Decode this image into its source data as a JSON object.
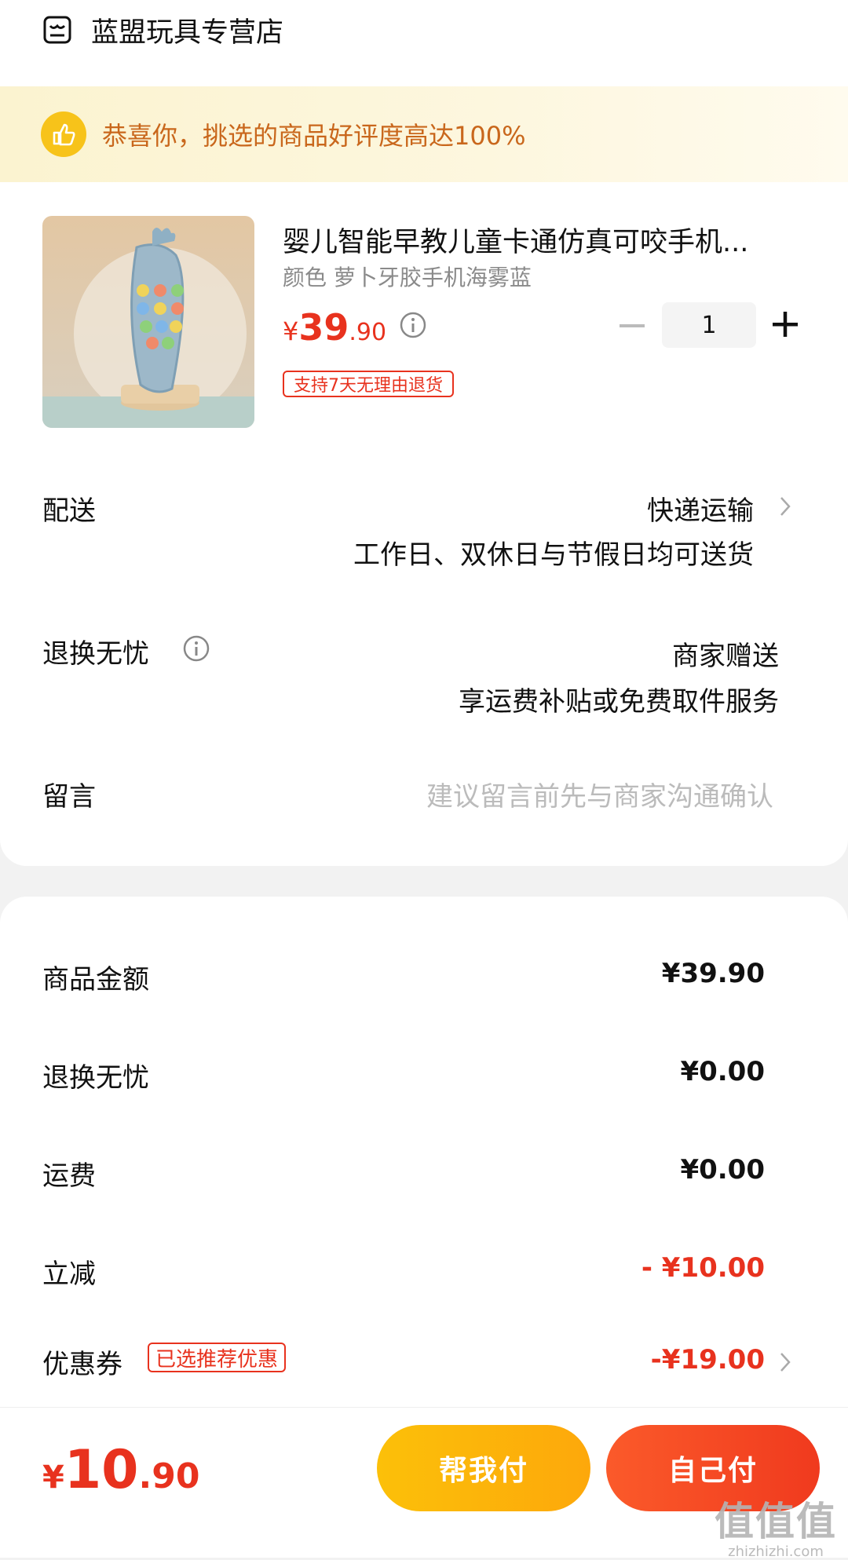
{
  "store": {
    "name": "蓝盟玩具专营店",
    "icon": "store-icon"
  },
  "banner": {
    "text": "恭喜你，挑选的商品好评度高达100%",
    "icon": "thumbs-up-icon"
  },
  "product": {
    "title": "婴儿智能早教儿童卡通仿真可咬手机...",
    "variant": "颜色 萝卜牙胶手机海雾蓝",
    "price_currency": "¥",
    "price_integer": "39",
    "price_decimal": ".90",
    "quantity": "1",
    "return_badge": "支持7天无理由退货",
    "image_label": "海雾蓝"
  },
  "delivery": {
    "label": "配送",
    "method": "快递运输",
    "note": "工作日、双休日与节假日均可送货"
  },
  "worry_free": {
    "label": "退换无忧",
    "value": "商家赠送",
    "note": "享运费补贴或免费取件服务"
  },
  "message": {
    "label": "留言",
    "placeholder": "建议留言前先与商家沟通确认"
  },
  "summary": {
    "goods_label": "商品金额",
    "goods_amount": "¥39.90",
    "worry_label": "退换无忧",
    "worry_amount": "¥0.00",
    "shipping_label": "运费",
    "shipping_amount": "¥0.00",
    "discount_label": "立减",
    "discount_amount": "- ¥10.00",
    "coupon_label": "优惠券",
    "coupon_badge": "已选推荐优惠",
    "coupon_amount": "-¥19.00"
  },
  "footer": {
    "total_currency": "¥",
    "total_integer": "10",
    "total_decimal": ".90",
    "help_pay_label": "帮我付",
    "self_pay_label": "自己付"
  },
  "watermark": {
    "line1": "值值值",
    "line2": "zhizhizhi.com"
  },
  "colors": {
    "accent_red": "#e8321e",
    "banner_text": "#c9671c",
    "help_pay": "#fcc009",
    "self_pay": "#f03a1e"
  }
}
